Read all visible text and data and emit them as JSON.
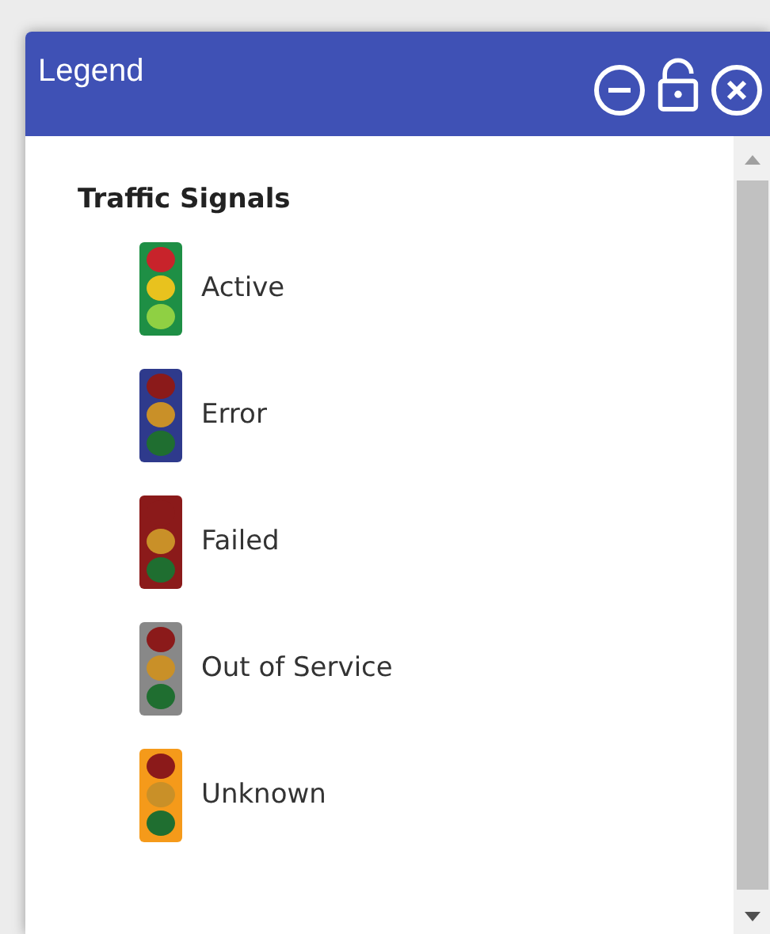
{
  "window": {
    "title": "Legend"
  },
  "layer": {
    "title": "Traffic Signals",
    "items": [
      {
        "label": "Active",
        "color": "#1e8f45",
        "lit": true
      },
      {
        "label": "Error",
        "color": "#2e3a8c",
        "lit": false
      },
      {
        "label": "Failed",
        "color": "#8b1a1a",
        "lit": false
      },
      {
        "label": "Out of Service",
        "color": "#888888",
        "lit": false
      },
      {
        "label": "Unknown",
        "color": "#f59a1a",
        "lit": false
      }
    ]
  }
}
